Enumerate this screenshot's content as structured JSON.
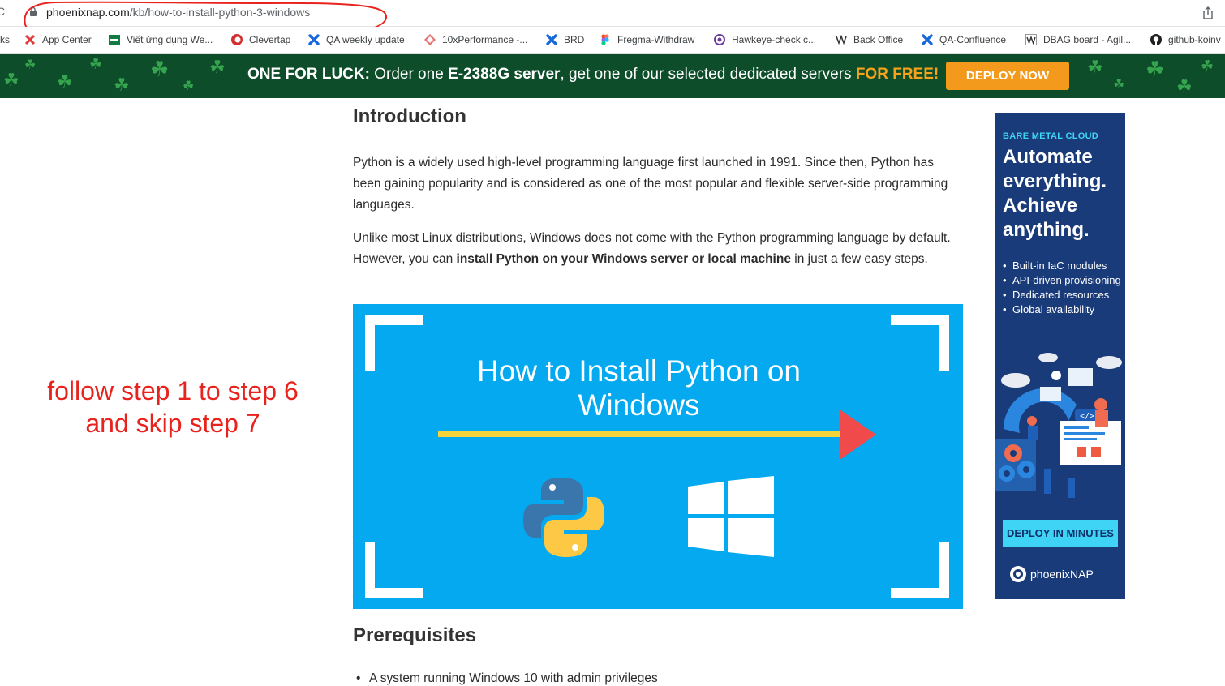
{
  "browser": {
    "url_host": "phoenixnap.com",
    "url_path": "/kb/how-to-install-python-3-windows"
  },
  "bookmarks": [
    {
      "label": "ks"
    },
    {
      "label": "App Center",
      "icon": "app-center-icon",
      "color": "#e23b3b"
    },
    {
      "label": "Viết ứng dụng We...",
      "icon": "green-flag-icon",
      "color": "#107c41"
    },
    {
      "label": "Clevertap",
      "icon": "clevertap-icon",
      "color": "#d32f2f"
    },
    {
      "label": "QA weekly update",
      "icon": "confluence-x-icon",
      "color": "#1868db"
    },
    {
      "label": "10xPerformance -...",
      "icon": "diamond-icon",
      "color": "#e57373"
    },
    {
      "label": "BRD",
      "icon": "confluence-x-icon",
      "color": "#1868db"
    },
    {
      "label": "Fregma-Withdraw",
      "icon": "figma-icon",
      "color": "#a259ff"
    },
    {
      "label": "Hawkeye-check c...",
      "icon": "target-icon",
      "color": "#6a3d9a"
    },
    {
      "label": "Back Office",
      "icon": "vv-icon",
      "color": "#333333"
    },
    {
      "label": "QA-Confluence",
      "icon": "confluence-x-icon",
      "color": "#1868db"
    },
    {
      "label": "DBAG board - Agil...",
      "icon": "vv-icon",
      "color": "#333333"
    },
    {
      "label": "github-koinv",
      "icon": "github-icon",
      "color": "#222222"
    }
  ],
  "promo": {
    "lead": "ONE FOR LUCK:",
    "text1": " Order one ",
    "product": "E-2388G server",
    "text2": ", get one of our selected dedicated servers ",
    "highlight": "FOR FREE!",
    "button": "DEPLOY NOW",
    "accent": "#f39a1d",
    "bg": "#0d4d2a"
  },
  "article": {
    "intro_heading": "Introduction",
    "para1": "Python is a widely used high-level programming language first launched in 1991. Since then, Python has been gaining popularity and is considered as one of the most popular and flexible server-side programming languages.",
    "para2_a": "Unlike most Linux distributions, Windows does not come with the Python programming language by default. However, you can ",
    "para2_bold": "install Python on your Windows server or local machine",
    "para2_b": " in just a few easy steps.",
    "hero_title": "How to Install Python on Windows",
    "prereq_heading": "Prerequisites",
    "prereq_items": [
      "A system running Windows 10 with admin privileges"
    ]
  },
  "ad": {
    "eyebrow": "BARE METAL CLOUD",
    "headline": "Automate everything. Achieve anything.",
    "bullets": [
      "Built-in IaC modules",
      "API-driven provisioning",
      "Dedicated resources",
      "Global availability"
    ],
    "button": "DEPLOY IN MINUTES",
    "brand": "phoenixNAP",
    "accent": "#3fd3f5"
  },
  "annotation": {
    "line1": "follow step 1 to step 6",
    "line2": "and skip step 7",
    "color": "#e8231e"
  }
}
